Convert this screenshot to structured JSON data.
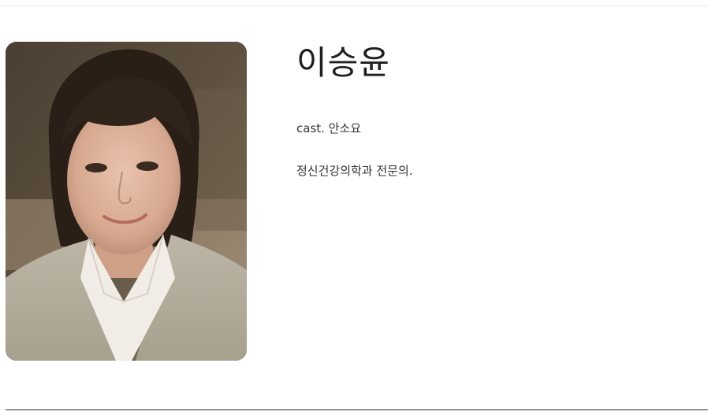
{
  "profile": {
    "name": "이승윤",
    "cast": "cast. 안소요",
    "description": "정신건강의학과 전문의.",
    "photo_icon": "actor-portrait"
  },
  "colors": {
    "top_rule": "#e6e6e6",
    "bottom_rule": "#2a2a2a",
    "text": "#222222"
  }
}
